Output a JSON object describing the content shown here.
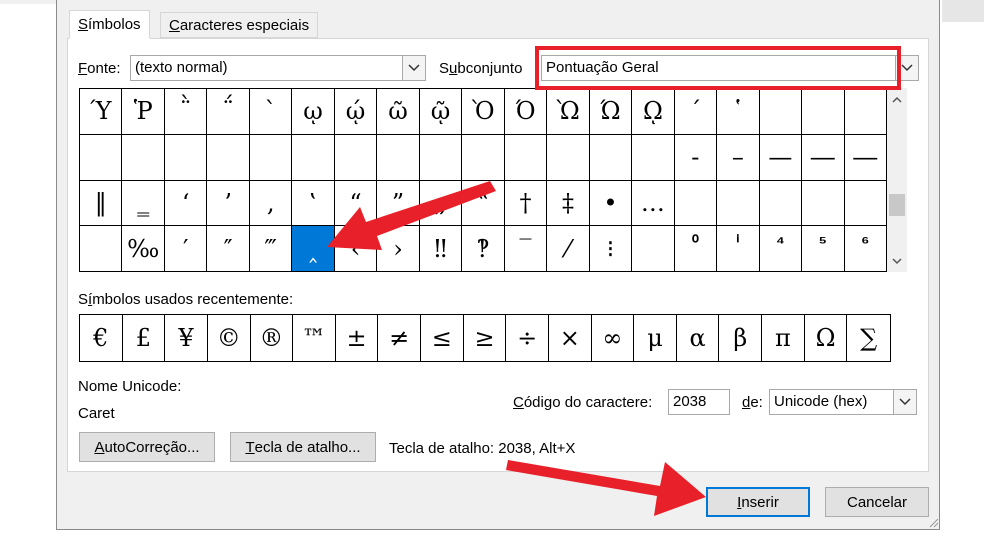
{
  "tabs": [
    {
      "label": "Símbolos",
      "mn": "S",
      "rest": "ímbolos"
    },
    {
      "label": "Caracteres especiais",
      "mn": "C",
      "rest": "aracteres especiais"
    }
  ],
  "font": {
    "label_mn": "F",
    "label_rest": "onte:",
    "value": "(texto normal)"
  },
  "subset": {
    "label_pre": "S",
    "label_mn": "u",
    "label_rest": "bconjunto",
    "value": "Pontuação Geral"
  },
  "grid": [
    [
      "Ύ",
      "Ῥ",
      "῭",
      "΅",
      "`",
      "ῳ",
      "ῴ",
      "ῶ",
      "ῷ",
      "Ὸ",
      "Ό",
      "Ὼ",
      "Ώ",
      "ῼ",
      "´",
      "῾",
      "",
      "",
      ""
    ],
    [
      "",
      "",
      "",
      "",
      "",
      "",
      "",
      "",
      "",
      "",
      "",
      "",
      "",
      "",
      "‐",
      "–",
      "—",
      "―",
      "―"
    ],
    [
      "‖",
      "‗",
      "‘",
      "’",
      "‚",
      "‛",
      "“",
      "”",
      "„",
      "‟",
      "†",
      "‡",
      "•",
      "…",
      "",
      "",
      "",
      "",
      ""
    ],
    [
      "",
      "‰",
      "′",
      "″",
      "‴",
      "‸",
      "‹",
      "›",
      "‼",
      "‽",
      "‾",
      "⁄",
      "⁝",
      "",
      "⁰",
      "ⁱ",
      "⁴",
      "⁵",
      "⁶"
    ]
  ],
  "selected": {
    "row": 3,
    "col": 5
  },
  "recent": {
    "label_pre": "S",
    "label_mn": "í",
    "label_rest": "mbolos usados recentemente:",
    "items": [
      "€",
      "£",
      "¥",
      "©",
      "®",
      "™",
      "±",
      "≠",
      "≤",
      "≥",
      "÷",
      "×",
      "∞",
      "μ",
      "α",
      "β",
      "π",
      "Ω",
      "∑"
    ]
  },
  "unicode_name": {
    "label": "Nome Unicode:",
    "value": "Caret"
  },
  "char_code": {
    "label_pre": "",
    "label_mn": "C",
    "label_rest": "ódigo do caractere:",
    "value": "2038"
  },
  "from": {
    "label_mn": "d",
    "label_rest": "e:",
    "value": "Unicode (hex)"
  },
  "buttons": {
    "autocorrect": {
      "mn": "A",
      "rest": "utoCorreção..."
    },
    "shortcut_key": {
      "mn": "T",
      "rest": "ecla de atalho..."
    },
    "insert": {
      "mn": "I",
      "rest": "nserir"
    },
    "cancel": "Cancelar"
  },
  "shortcut_text": "Tecla de atalho: 2038, Alt+X",
  "colors": {
    "highlight": "#0078d7",
    "annotation": "#e8202a"
  }
}
